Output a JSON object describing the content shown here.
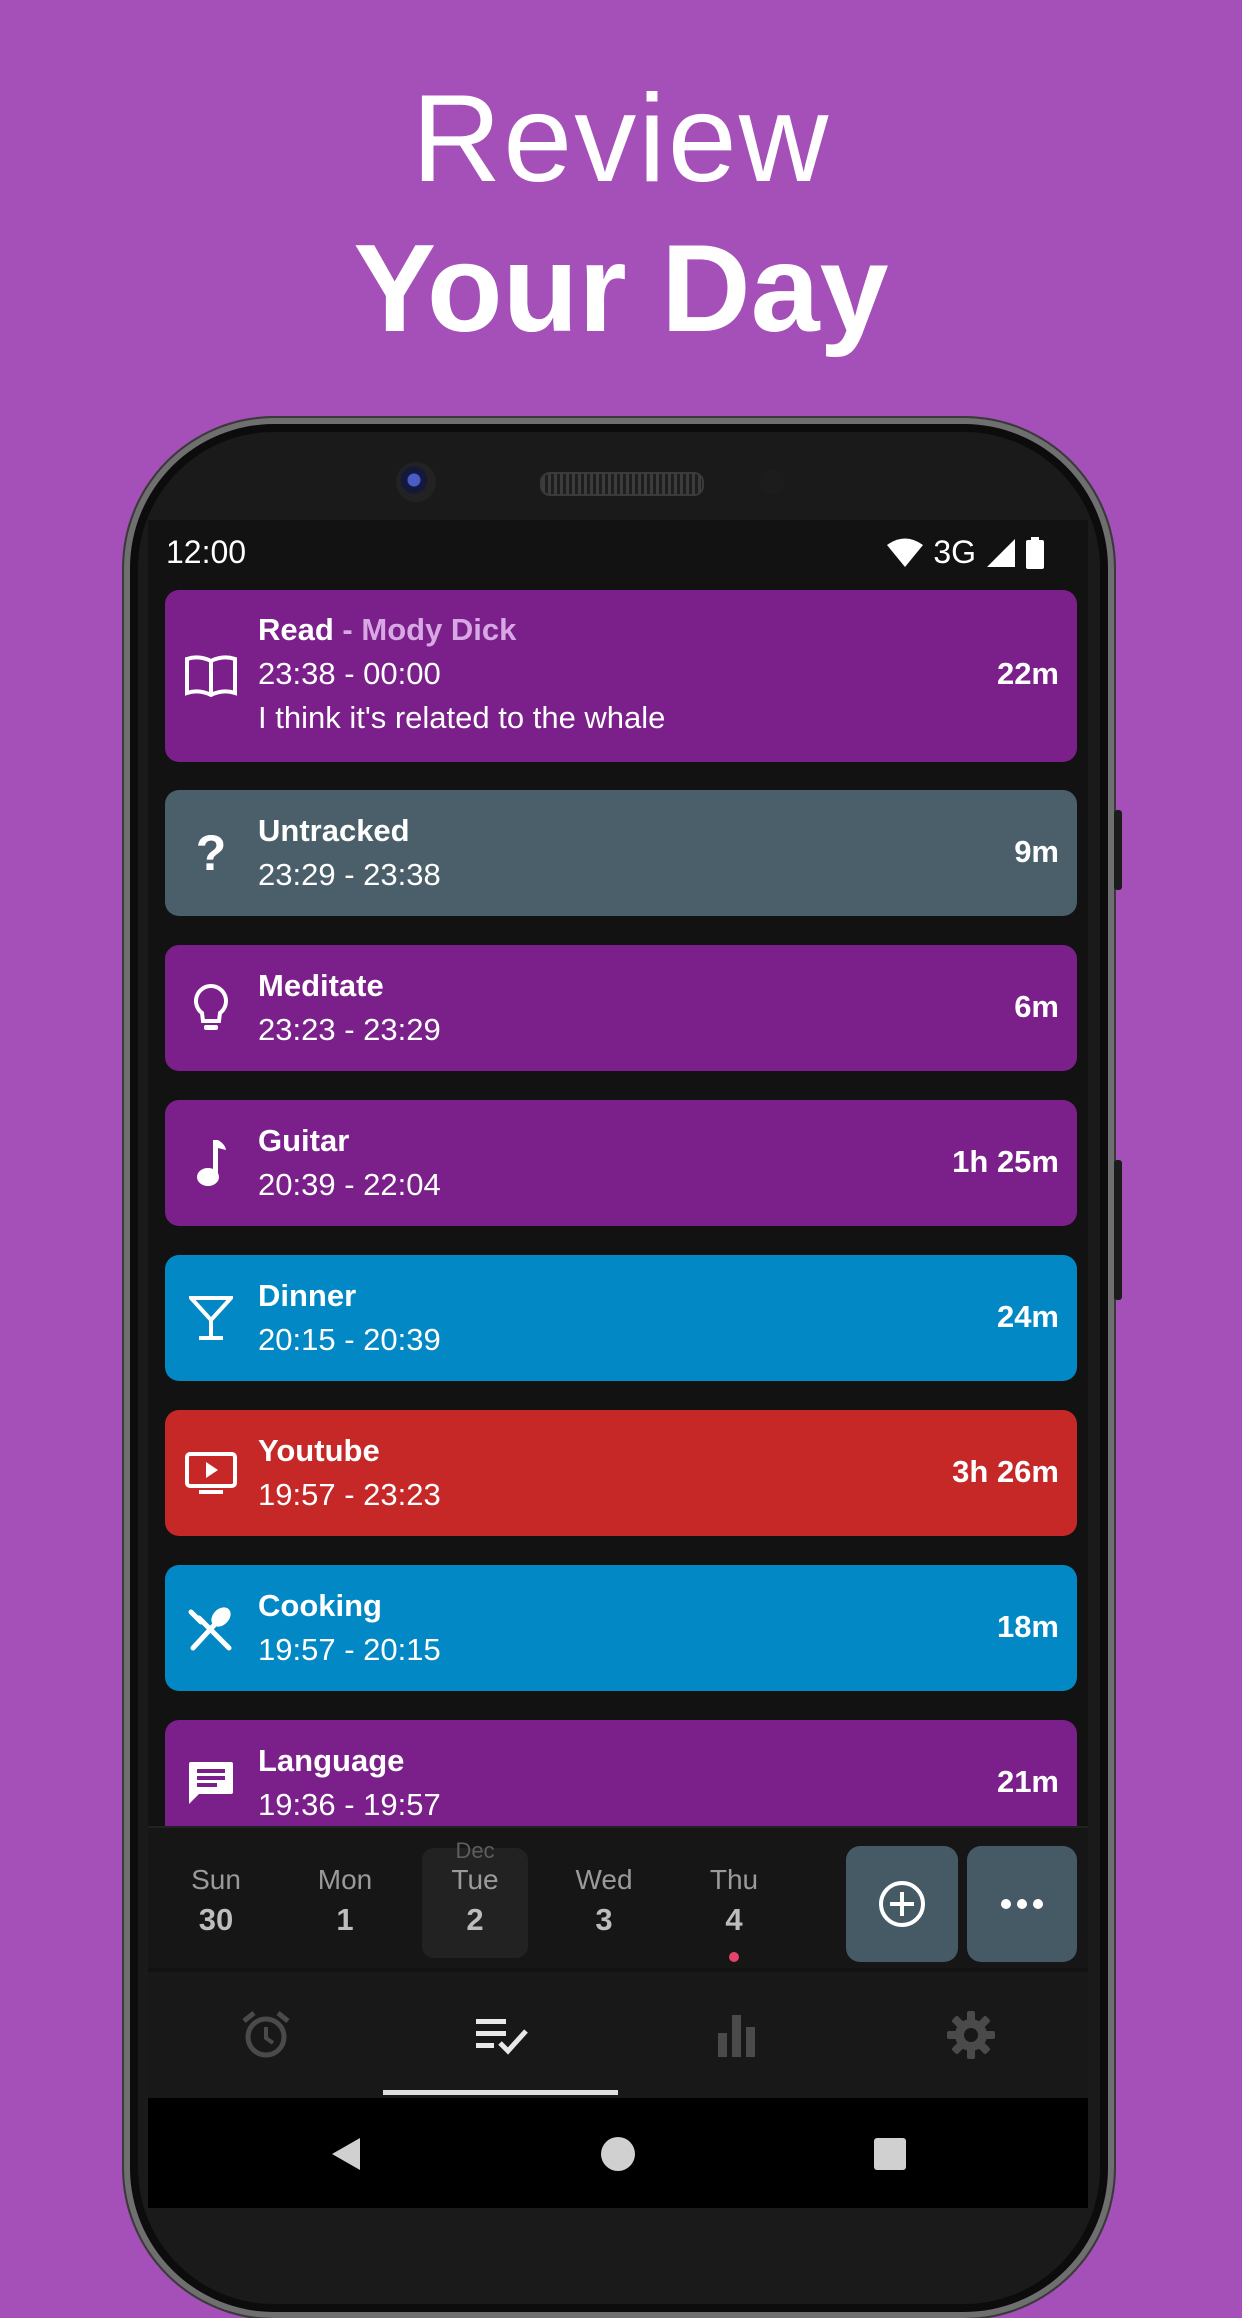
{
  "headline": {
    "line1": "Review",
    "line2": "Your Day"
  },
  "status": {
    "time": "12:00",
    "network": "3G"
  },
  "activities": [
    {
      "title": "Read",
      "subtitle": "Mody Dick",
      "time": "23:38  -  00:00",
      "note": "I think it's related to the whale",
      "duration": "22m",
      "icon": "book-icon",
      "color": "#7b1f8a"
    },
    {
      "title": "Untracked",
      "time": "23:29  -  23:38",
      "duration": "9m",
      "icon": "question-icon",
      "color": "#4a5f69"
    },
    {
      "title": "Meditate",
      "time": "23:23  -  23:29",
      "duration": "6m",
      "icon": "lightbulb-icon",
      "color": "#7b1f8a"
    },
    {
      "title": "Guitar",
      "time": "20:39  -  22:04",
      "duration": "1h 25m",
      "icon": "music-note-icon",
      "color": "#7b1f8a"
    },
    {
      "title": "Dinner",
      "time": "20:15  -  20:39",
      "duration": "24m",
      "icon": "cocktail-glass-icon",
      "color": "#0288c4"
    },
    {
      "title": "Youtube",
      "time": "19:57  -  23:23",
      "duration": "3h 26m",
      "icon": "tv-play-icon",
      "color": "#c62828"
    },
    {
      "title": "Cooking",
      "time": "19:57  -  20:15",
      "duration": "18m",
      "icon": "utensils-icon",
      "color": "#0288c4"
    },
    {
      "title": "Language",
      "time": "19:36  -  19:57",
      "duration": "21m",
      "icon": "chat-icon",
      "color": "#7b1f8a"
    }
  ],
  "days": [
    {
      "name": "Sun",
      "num": "30"
    },
    {
      "name": "Mon",
      "num": "1"
    },
    {
      "name": "Tue",
      "num": "2",
      "month": "Dec",
      "selected": true
    },
    {
      "name": "Wed",
      "num": "3"
    },
    {
      "name": "Thu",
      "num": "4",
      "dot": true
    }
  ],
  "nav": [
    "alarm-clock-icon",
    "checklist-icon",
    "bar-chart-icon",
    "gear-icon"
  ],
  "colors": {
    "background": "#a450b8",
    "screen": "#121212",
    "fab": "#455a64",
    "today_dot": "#e5436b"
  }
}
